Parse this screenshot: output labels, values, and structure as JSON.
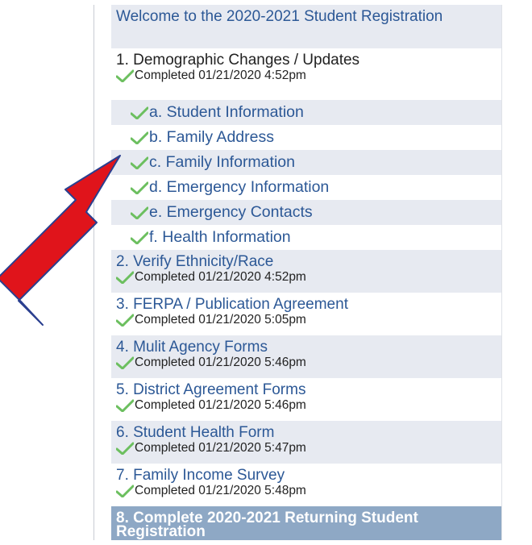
{
  "nav": {
    "welcome": "Welcome to the 2020-2021 Student Registration",
    "sections": [
      {
        "title": "1. Demographic Changes / Updates",
        "status": "Completed 01/21/2020 4:52pm"
      },
      {
        "title": "2. Verify Ethnicity/Race",
        "status": "Completed 01/21/2020 4:52pm"
      },
      {
        "title": "3. FERPA / Publication Agreement",
        "status": "Completed 01/21/2020 5:05pm"
      },
      {
        "title": "4. Mulit Agency Forms",
        "status": "Completed 01/21/2020 5:46pm"
      },
      {
        "title": "5. District Agreement Forms",
        "status": "Completed 01/21/2020 5:46pm"
      },
      {
        "title": "6. Student Health Form",
        "status": "Completed 01/21/2020 5:47pm"
      },
      {
        "title": "7. Family Income Survey",
        "status": "Completed 01/21/2020 5:48pm"
      },
      {
        "title": "8. Complete 2020-2021 Returning Student Registration"
      }
    ],
    "substeps": [
      "a. Student Information",
      "b. Family Address",
      "c. Family Information",
      "d. Emergency Information",
      "e. Emergency Contacts",
      "f. Health Information"
    ]
  },
  "icons": {
    "check": "check-icon",
    "arrow": "red-arrow-icon"
  },
  "colors": {
    "link": "#2c5896",
    "row_alt": "#e7eaf1",
    "current_bg": "#8ea8c5",
    "check": "#6cbf5f",
    "arrow": "#e0141b"
  }
}
